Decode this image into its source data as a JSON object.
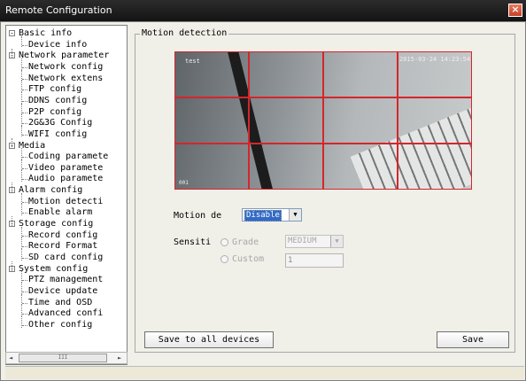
{
  "window": {
    "title": "Remote Configuration",
    "close_glyph": "×"
  },
  "tree": {
    "items": [
      {
        "label": "Basic info",
        "level": 0,
        "expander": "minus"
      },
      {
        "label": "Device info",
        "level": 1
      },
      {
        "label": "Network parameter",
        "level": 0,
        "expander": "minus"
      },
      {
        "label": "Network config",
        "level": 1
      },
      {
        "label": "Network extens",
        "level": 1
      },
      {
        "label": "FTP config",
        "level": 1
      },
      {
        "label": "DDNS config",
        "level": 1
      },
      {
        "label": "P2P config",
        "level": 1
      },
      {
        "label": "2G&3G Config",
        "level": 1
      },
      {
        "label": "WIFI config",
        "level": 1
      },
      {
        "label": "Media",
        "level": 0,
        "expander": "minus"
      },
      {
        "label": "Coding paramete",
        "level": 1
      },
      {
        "label": "Video paramete",
        "level": 1
      },
      {
        "label": "Audio paramete",
        "level": 1
      },
      {
        "label": "Alarm config",
        "level": 0,
        "expander": "minus"
      },
      {
        "label": "Motion detecti",
        "level": 1
      },
      {
        "label": "Enable alarm",
        "level": 1
      },
      {
        "label": "Storage config",
        "level": 0,
        "expander": "minus"
      },
      {
        "label": "Record config",
        "level": 1
      },
      {
        "label": "Record Format",
        "level": 1
      },
      {
        "label": "SD card config",
        "level": 1
      },
      {
        "label": "System config",
        "level": 0,
        "expander": "minus"
      },
      {
        "label": "PTZ management",
        "level": 1
      },
      {
        "label": "Device update",
        "level": 1
      },
      {
        "label": "Time and OSD",
        "level": 1
      },
      {
        "label": "Advanced confi",
        "level": 1
      },
      {
        "label": "Other config",
        "level": 1
      }
    ],
    "scroll": {
      "left": "◄",
      "right": "►",
      "grip": "III"
    }
  },
  "panel": {
    "title": "Motion detection",
    "video": {
      "label_tl": "test",
      "timestamp": "2015-03-24 14:23:54",
      "label_bl": "001"
    },
    "grid": {
      "rows": 3,
      "cols": 4
    },
    "motion_label": "Motion de",
    "motion_value": "Disable",
    "sensitivity_label": "Sensiti",
    "grade_label": "Grade",
    "grade_value": "MEDIUM",
    "custom_label": "Custom",
    "custom_value": "1",
    "dropdown_arrow": "▼"
  },
  "buttons": {
    "save_all": "Save to all devices",
    "save": "Save"
  },
  "colors": {
    "grid": "#d4262b",
    "selection": "#316ac5"
  }
}
